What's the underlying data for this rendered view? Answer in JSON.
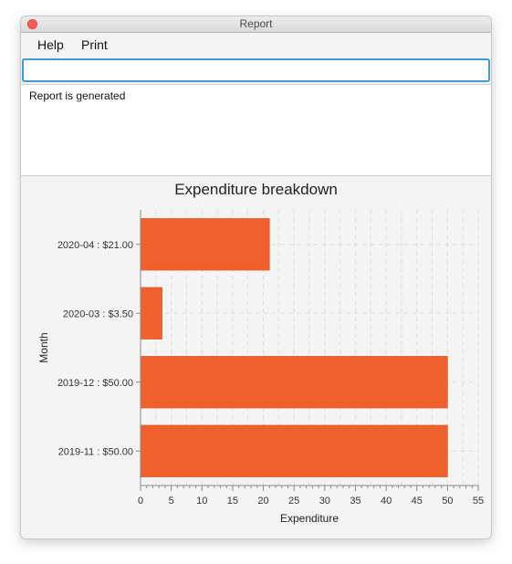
{
  "window": {
    "title": "Report"
  },
  "menu": {
    "items": [
      "Help",
      "Print"
    ]
  },
  "command_input": {
    "value": ""
  },
  "result_display": {
    "text": "Report is generated"
  },
  "colors": {
    "bar": "#f0602d",
    "focus": "#3f9ad6",
    "close_button": "#fd5d56"
  },
  "chart_data": {
    "type": "bar",
    "orientation": "horizontal",
    "title": "Expenditure breakdown",
    "xlabel": "Expenditure",
    "ylabel": "Month",
    "categories": [
      "2020-04 : $21.00",
      "2020-03 : $3.50",
      "2019-12 : $50.00",
      "2019-11 : $50.00"
    ],
    "values": [
      21,
      3.5,
      50,
      50
    ],
    "xlim": [
      0,
      55
    ],
    "xticks": [
      0,
      5,
      10,
      15,
      20,
      25,
      30,
      35,
      40,
      45,
      50,
      55
    ],
    "grid": true,
    "legend": false
  }
}
